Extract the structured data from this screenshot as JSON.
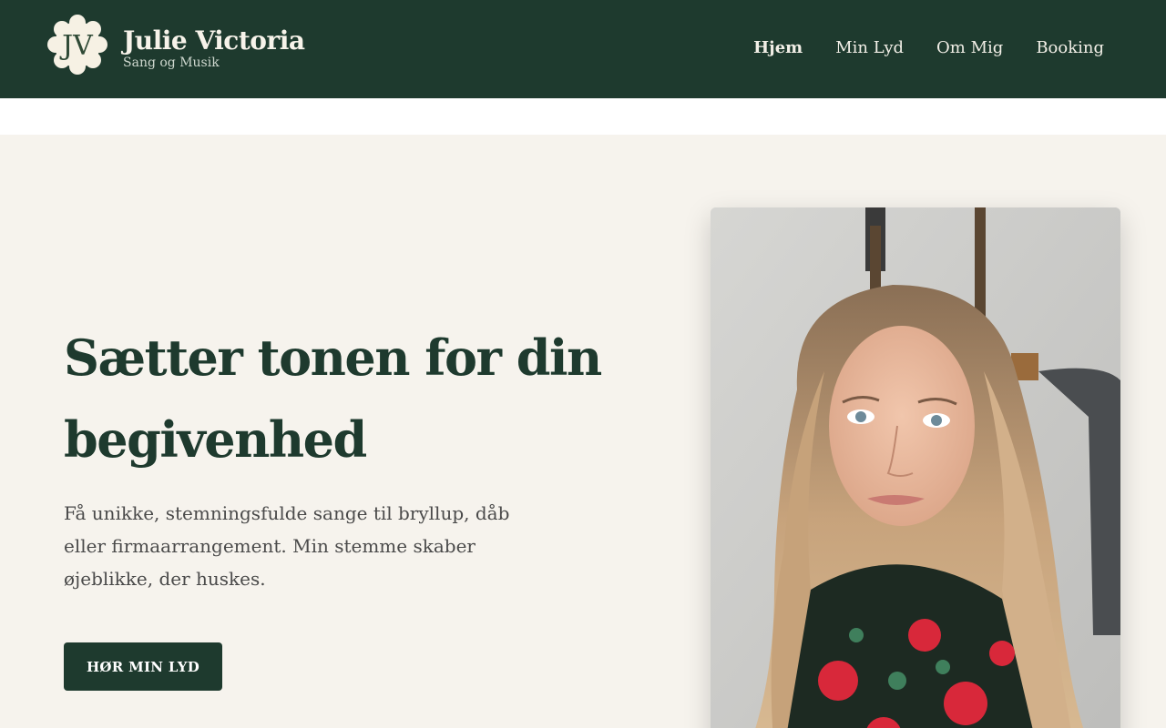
{
  "header": {
    "logo": {
      "monogram": "JV",
      "icon": "scalloped-monogram-badge"
    },
    "brand_name": "Julie Victoria",
    "tagline": "Sang og Musik",
    "nav": [
      {
        "label": "Hjem",
        "active": true
      },
      {
        "label": "Min Lyd",
        "active": false
      },
      {
        "label": "Om Mig",
        "active": false
      },
      {
        "label": "Booking",
        "active": false
      }
    ]
  },
  "hero": {
    "headline": "Sætter tonen for din begivenhed",
    "intro": "Få unikke, stemningsfulde sange til bryllup, dåb eller firmaarrangement. Min stemme skaber øjeblikke, der huskes.",
    "cta_label": "HØR MIN LYD",
    "image": {
      "subject": "portrait-photo"
    }
  },
  "colors": {
    "header_bg": "#1e3a2e",
    "hero_bg": "#f6f3ed",
    "accent": "#1e3a2e",
    "logo_badge": "#f6f1e4"
  }
}
